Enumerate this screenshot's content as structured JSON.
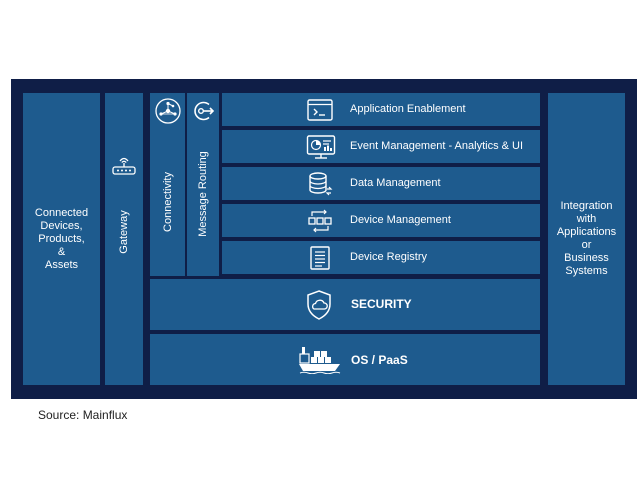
{
  "left_block": {
    "label": "Connected\nDevices,\nProducts,\n&\nAssets"
  },
  "gateway": {
    "label": "Gateway"
  },
  "connectivity": {
    "label": "Connectivity"
  },
  "message_routing": {
    "label": "Message Routing"
  },
  "layers": [
    {
      "label": "Application Enablement",
      "icon": "terminal-icon"
    },
    {
      "label": "Event Management - Analytics & UI",
      "icon": "dashboard-monitor-icon"
    },
    {
      "label": "Data Management",
      "icon": "database-icon"
    },
    {
      "label": "Device Management",
      "icon": "device-network-icon"
    },
    {
      "label": "Device Registry",
      "icon": "registry-list-icon"
    }
  ],
  "security": {
    "label": "SECURITY",
    "icon": "shield-cloud-icon"
  },
  "os_paas": {
    "label": "OS / PaaS",
    "icon": "container-ship-icon"
  },
  "right_block": {
    "label": "Integration\nwith\nApplications\nor\nBusiness\nSystems"
  },
  "source": "Source: Mainflux",
  "colors": {
    "background": "#0f1e47",
    "block": "#1e5b8e",
    "text": "#ffffff"
  }
}
